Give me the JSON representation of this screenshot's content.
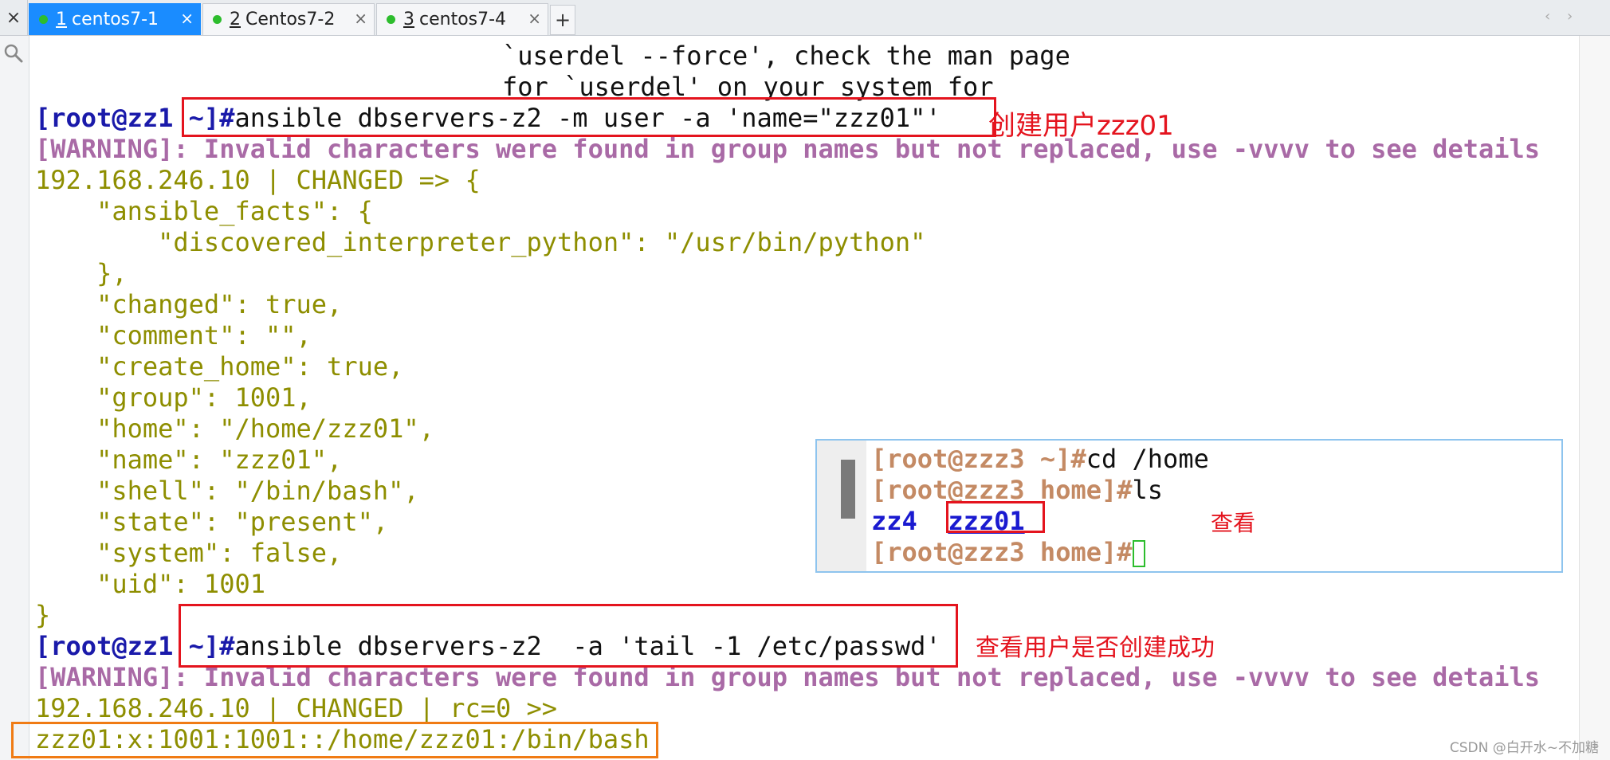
{
  "tabs": [
    {
      "num": "1",
      "label": "centos7-1",
      "active": true
    },
    {
      "num": "2",
      "label": "Centos7-2",
      "active": false
    },
    {
      "num": "3",
      "label": "centos7-4",
      "active": false
    }
  ],
  "tabbar": {
    "close_glyph": "×",
    "plus_glyph": "+",
    "tab_close_glyph": "×",
    "nav_left": "‹",
    "nav_right": "›"
  },
  "terminal": {
    "partial_1": "`userdel --force', check the man page",
    "partial_2": "for `userdel' on your system for",
    "prompt": "[root@zz1 ~]#",
    "cmd1": "ansible dbservers-z2 -m user -a 'name=\"zzz01\"'",
    "warning": "[WARNING]: Invalid characters were found in group names but not replaced, use -vvvv to see details",
    "result1_header": "192.168.246.10 | CHANGED => {",
    "json_lines": [
      "    \"ansible_facts\": {",
      "        \"discovered_interpreter_python\": \"/usr/bin/python\"",
      "    },",
      "    \"changed\": true,",
      "    \"comment\": \"\",",
      "    \"create_home\": true,",
      "    \"group\": 1001,",
      "    \"home\": \"/home/zzz01\",",
      "    \"name\": \"zzz01\",",
      "    \"shell\": \"/bin/bash\",",
      "    \"state\": \"present\",",
      "    \"system\": false,",
      "    \"uid\": 1001",
      "}"
    ],
    "cmd2": "ansible dbservers-z2  -a 'tail -1 /etc/passwd'",
    "warning2": "[WARNING]: Invalid characters were found in group names but not replaced, use -vvvv to see details",
    "result2_header": "192.168.246.10 | CHANGED | rc=0 >>",
    "passwd_line": "zzz01:x:1001:1001::/home/zzz01:/bin/bash"
  },
  "annotations": {
    "create_user": "创建用户zzz01",
    "view": "查看",
    "check_created": "查看用户是否创建成功"
  },
  "inset": {
    "prompt1": "[root@zzz3 ~]#",
    "cmd1": "cd /home",
    "prompt2": "[root@zzz3 home]#",
    "cmd2": "ls",
    "dir1": "zz4",
    "dir2": "zzz01",
    "prompt3": "[root@zzz3 home]#"
  },
  "watermark": "CSDN @白开水~不加糖",
  "colors": {
    "tab_active": "#1a8cff",
    "prompt": "#1a1aaa",
    "warning": "#a96aa6",
    "output": "#8e8e00",
    "annotation": "#e4141e",
    "highlight": "#f07b14"
  }
}
